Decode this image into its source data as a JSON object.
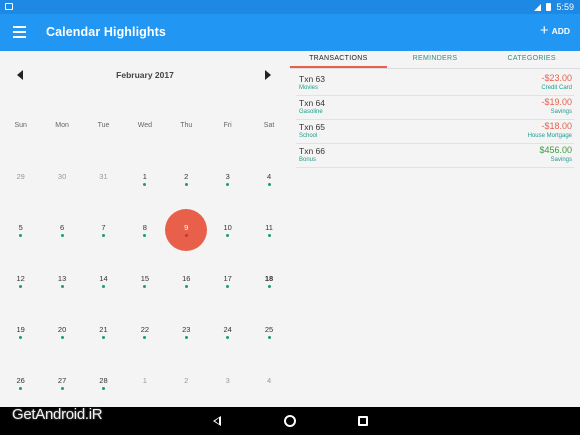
{
  "status_bar": {
    "time": "5:59"
  },
  "app_bar": {
    "title": "Calendar Highlights",
    "add_label": "ADD"
  },
  "calendar": {
    "month_label": "February 2017",
    "weekdays": [
      "Sun",
      "Mon",
      "Tue",
      "Wed",
      "Thu",
      "Fri",
      "Sat"
    ],
    "days": [
      {
        "n": "29",
        "other": true,
        "dot": false
      },
      {
        "n": "30",
        "other": true,
        "dot": false
      },
      {
        "n": "31",
        "other": true,
        "dot": false
      },
      {
        "n": "1",
        "other": false,
        "dot": true
      },
      {
        "n": "2",
        "other": false,
        "dot": true
      },
      {
        "n": "3",
        "other": false,
        "dot": true
      },
      {
        "n": "4",
        "other": false,
        "dot": true
      },
      {
        "n": "5",
        "other": false,
        "dot": true
      },
      {
        "n": "6",
        "other": false,
        "dot": true
      },
      {
        "n": "7",
        "other": false,
        "dot": true
      },
      {
        "n": "8",
        "other": false,
        "dot": true
      },
      {
        "n": "9",
        "other": false,
        "dot": true,
        "selected": true
      },
      {
        "n": "10",
        "other": false,
        "dot": true
      },
      {
        "n": "11",
        "other": false,
        "dot": true
      },
      {
        "n": "12",
        "other": false,
        "dot": true
      },
      {
        "n": "13",
        "other": false,
        "dot": true
      },
      {
        "n": "14",
        "other": false,
        "dot": true
      },
      {
        "n": "15",
        "other": false,
        "dot": true
      },
      {
        "n": "16",
        "other": false,
        "dot": true
      },
      {
        "n": "17",
        "other": false,
        "dot": true
      },
      {
        "n": "18",
        "other": false,
        "dot": true,
        "bold": true
      },
      {
        "n": "19",
        "other": false,
        "dot": true
      },
      {
        "n": "20",
        "other": false,
        "dot": true
      },
      {
        "n": "21",
        "other": false,
        "dot": true
      },
      {
        "n": "22",
        "other": false,
        "dot": true
      },
      {
        "n": "23",
        "other": false,
        "dot": true
      },
      {
        "n": "24",
        "other": false,
        "dot": true
      },
      {
        "n": "25",
        "other": false,
        "dot": true
      },
      {
        "n": "26",
        "other": false,
        "dot": true
      },
      {
        "n": "27",
        "other": false,
        "dot": true
      },
      {
        "n": "28",
        "other": false,
        "dot": true
      },
      {
        "n": "1",
        "other": true,
        "dot": false
      },
      {
        "n": "2",
        "other": true,
        "dot": false
      },
      {
        "n": "3",
        "other": true,
        "dot": false
      },
      {
        "n": "4",
        "other": true,
        "dot": false
      }
    ]
  },
  "tabs": [
    {
      "label": "TRANSACTIONS",
      "active": true
    },
    {
      "label": "REMINDERS",
      "active": false
    },
    {
      "label": "CATEGORIES",
      "active": false
    }
  ],
  "transactions": [
    {
      "name": "Txn 63",
      "category": "Movies",
      "amount": "-$23.00",
      "account": "Credit Card",
      "type": "neg"
    },
    {
      "name": "Txn 64",
      "category": "Gasoline",
      "amount": "-$19.00",
      "account": "Savings",
      "type": "neg"
    },
    {
      "name": "Txn 65",
      "category": "School",
      "amount": "-$18.00",
      "account": "House Mortgage",
      "type": "neg"
    },
    {
      "name": "Txn 66",
      "category": "Bonus",
      "amount": "$456.00",
      "account": "Savings",
      "type": "pos"
    }
  ],
  "watermark": "GetAndroid.iR",
  "colors": {
    "app_bar": "#2196f3",
    "status_bar": "#1e88e5",
    "accent": "#e8604a",
    "teal": "#1a9e8e",
    "positive": "#3c9d3c"
  }
}
